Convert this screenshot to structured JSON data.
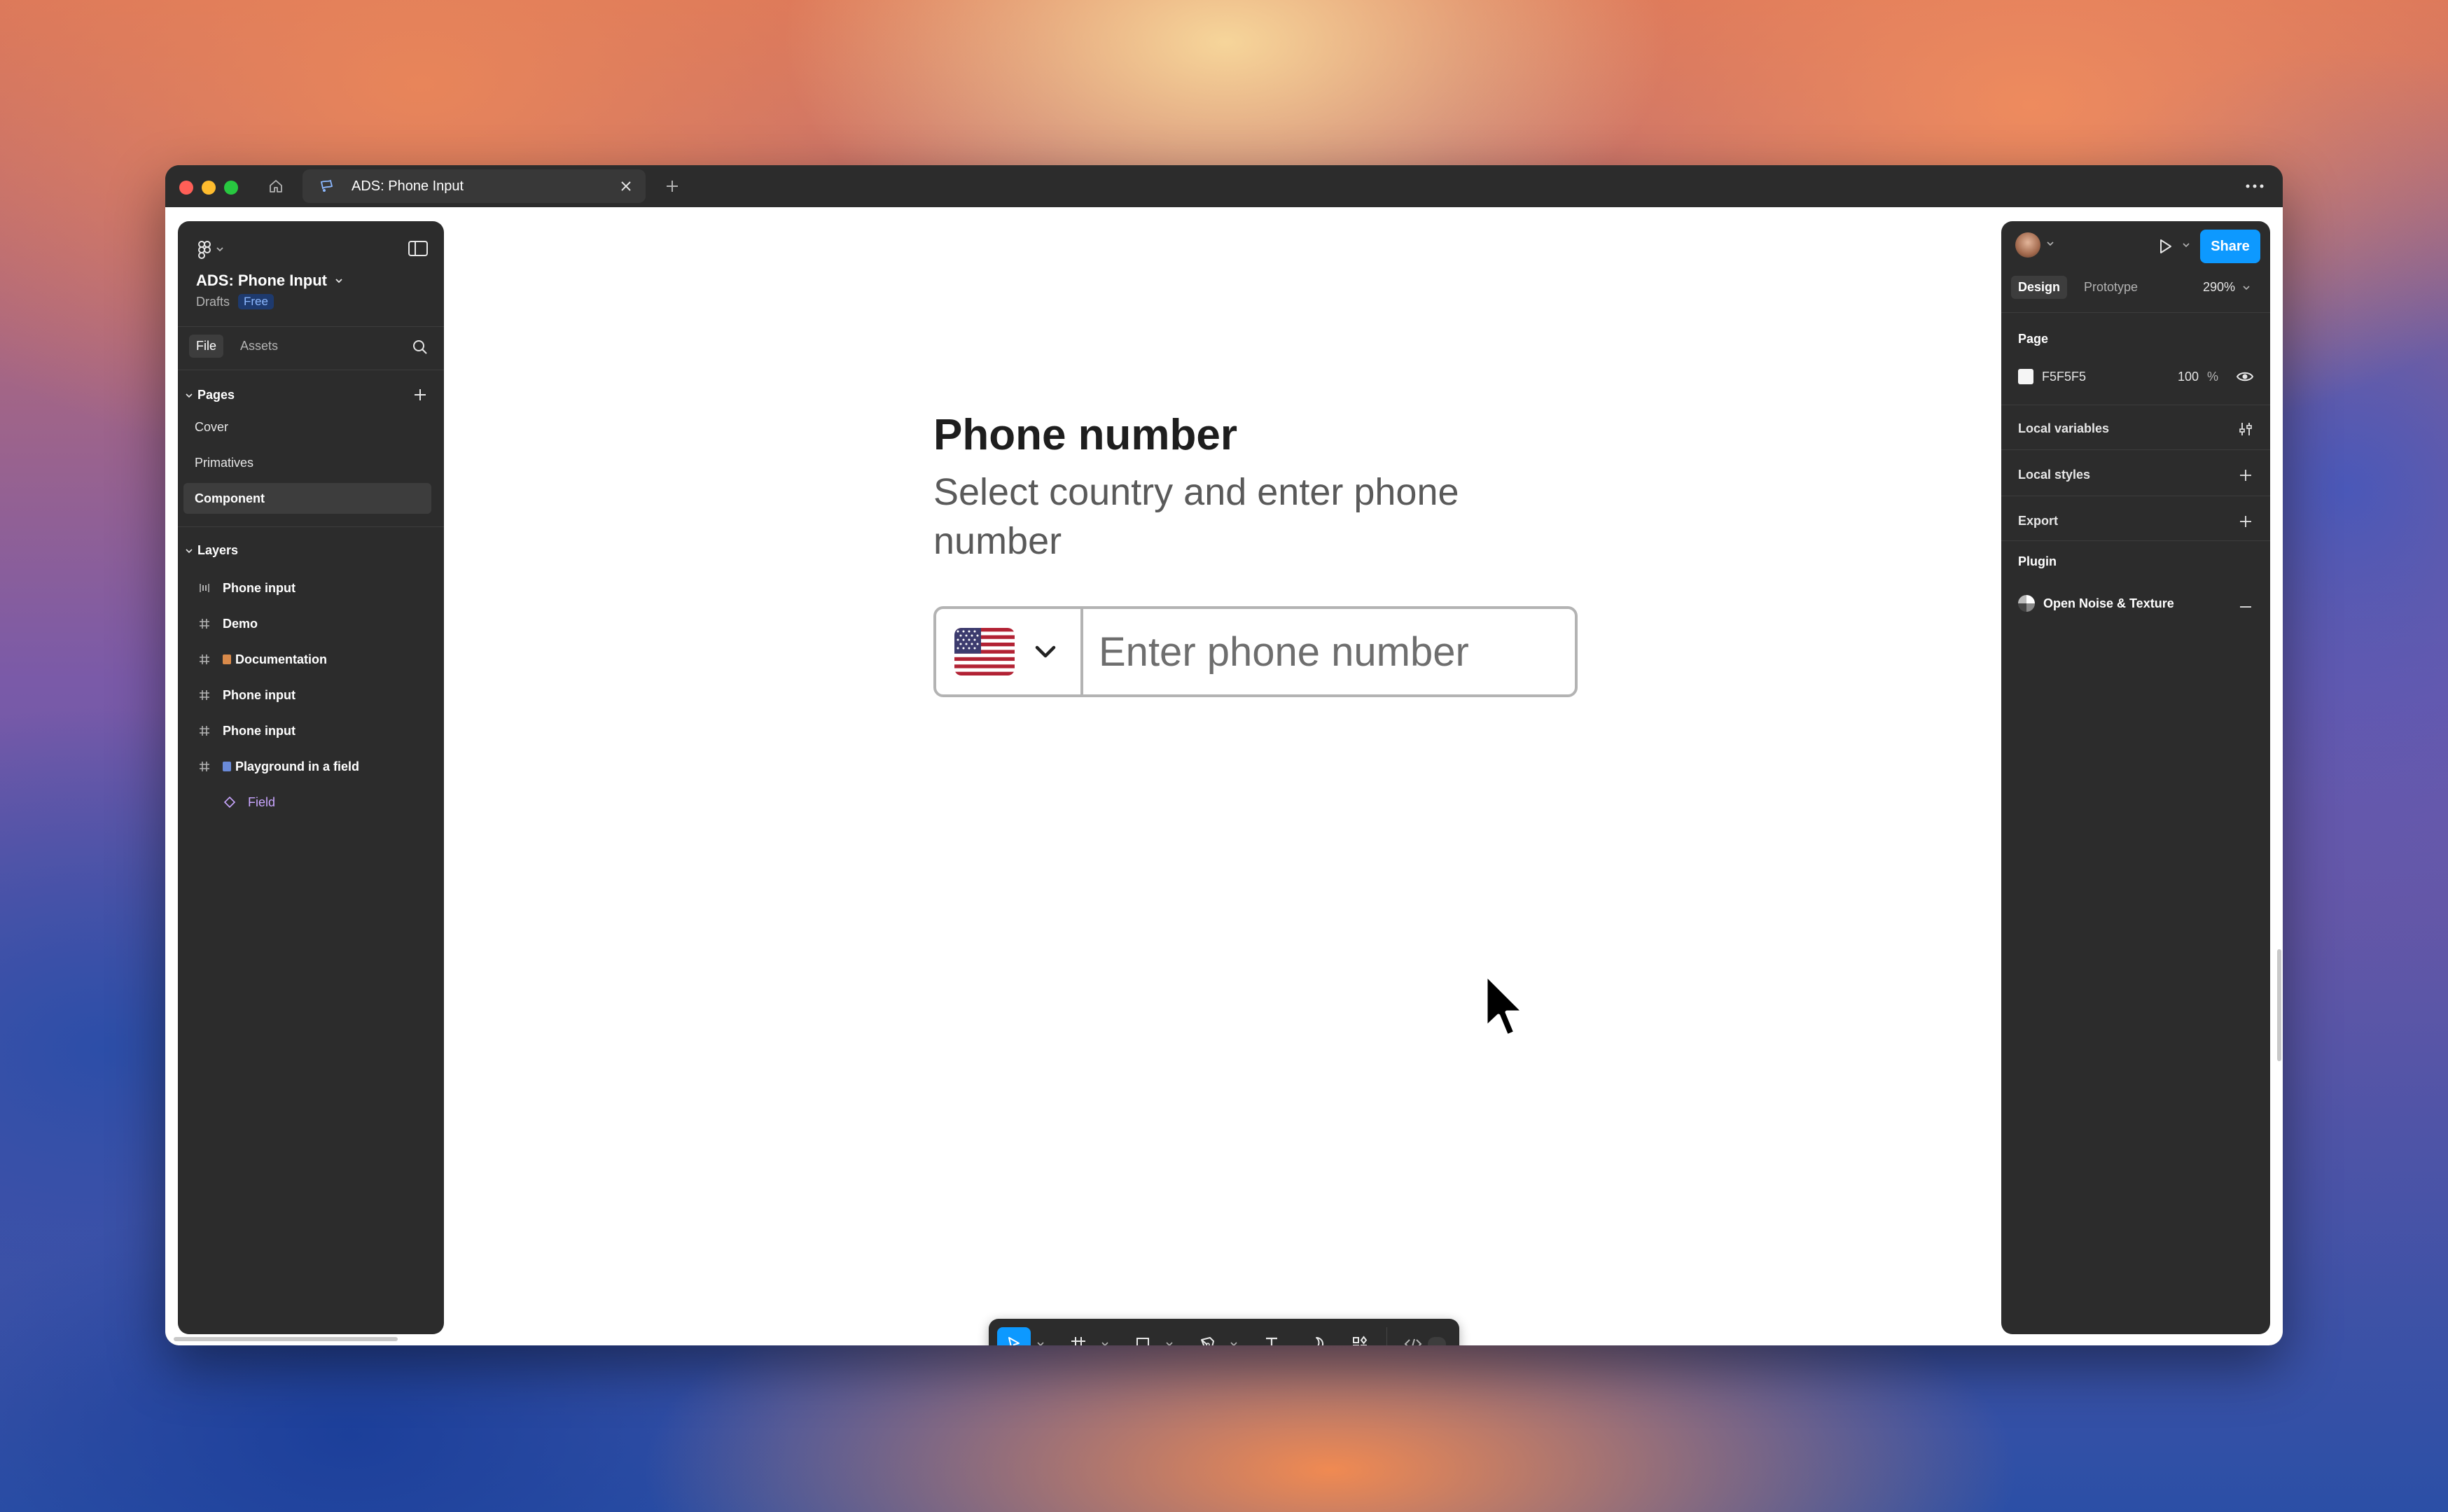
{
  "tab": {
    "title": "ADS: Phone Input"
  },
  "left_panel": {
    "file_name": "ADS: Phone Input",
    "location": "Drafts",
    "plan_badge": "Free",
    "tabs": [
      "File",
      "Assets"
    ],
    "pages_header": "Pages",
    "pages": [
      {
        "label": "Cover"
      },
      {
        "label": "Primatives"
      },
      {
        "label": "Component"
      }
    ],
    "layers_header": "Layers",
    "layers": [
      {
        "label": "Phone input",
        "icon": "autolayout-icon"
      },
      {
        "label": "Demo",
        "icon": "frame-icon"
      },
      {
        "label": "Documentation",
        "icon": "frame-icon"
      },
      {
        "label": "Phone input",
        "icon": "frame-icon"
      },
      {
        "label": "Phone input",
        "icon": "frame-icon"
      },
      {
        "label": "Playground in a field",
        "icon": "frame-icon"
      },
      {
        "label": "Field",
        "icon": "component-instance-icon"
      }
    ]
  },
  "right_panel": {
    "share_label": "Share",
    "tabs": [
      "Design",
      "Prototype"
    ],
    "zoom": "290%",
    "page_section": "Page",
    "page_color_hex": "F5F5F5",
    "page_opacity": "100",
    "page_opacity_unit": "%",
    "local_variables": "Local variables",
    "local_styles": "Local styles",
    "export": "Export",
    "plugin_section": "Plugin",
    "plugin_name": "Open Noise & Texture"
  },
  "canvas": {
    "title": "Phone number",
    "subtitle": "Select country and enter phone number",
    "phone_placeholder": "Enter phone number",
    "selected_country_flag": "us-flag-icon"
  },
  "colors": {
    "accent": "#0d99ff",
    "panel_bg": "#2c2c2c",
    "canvas_bg": "#ffffff",
    "page_bg": "#F5F5F5"
  }
}
